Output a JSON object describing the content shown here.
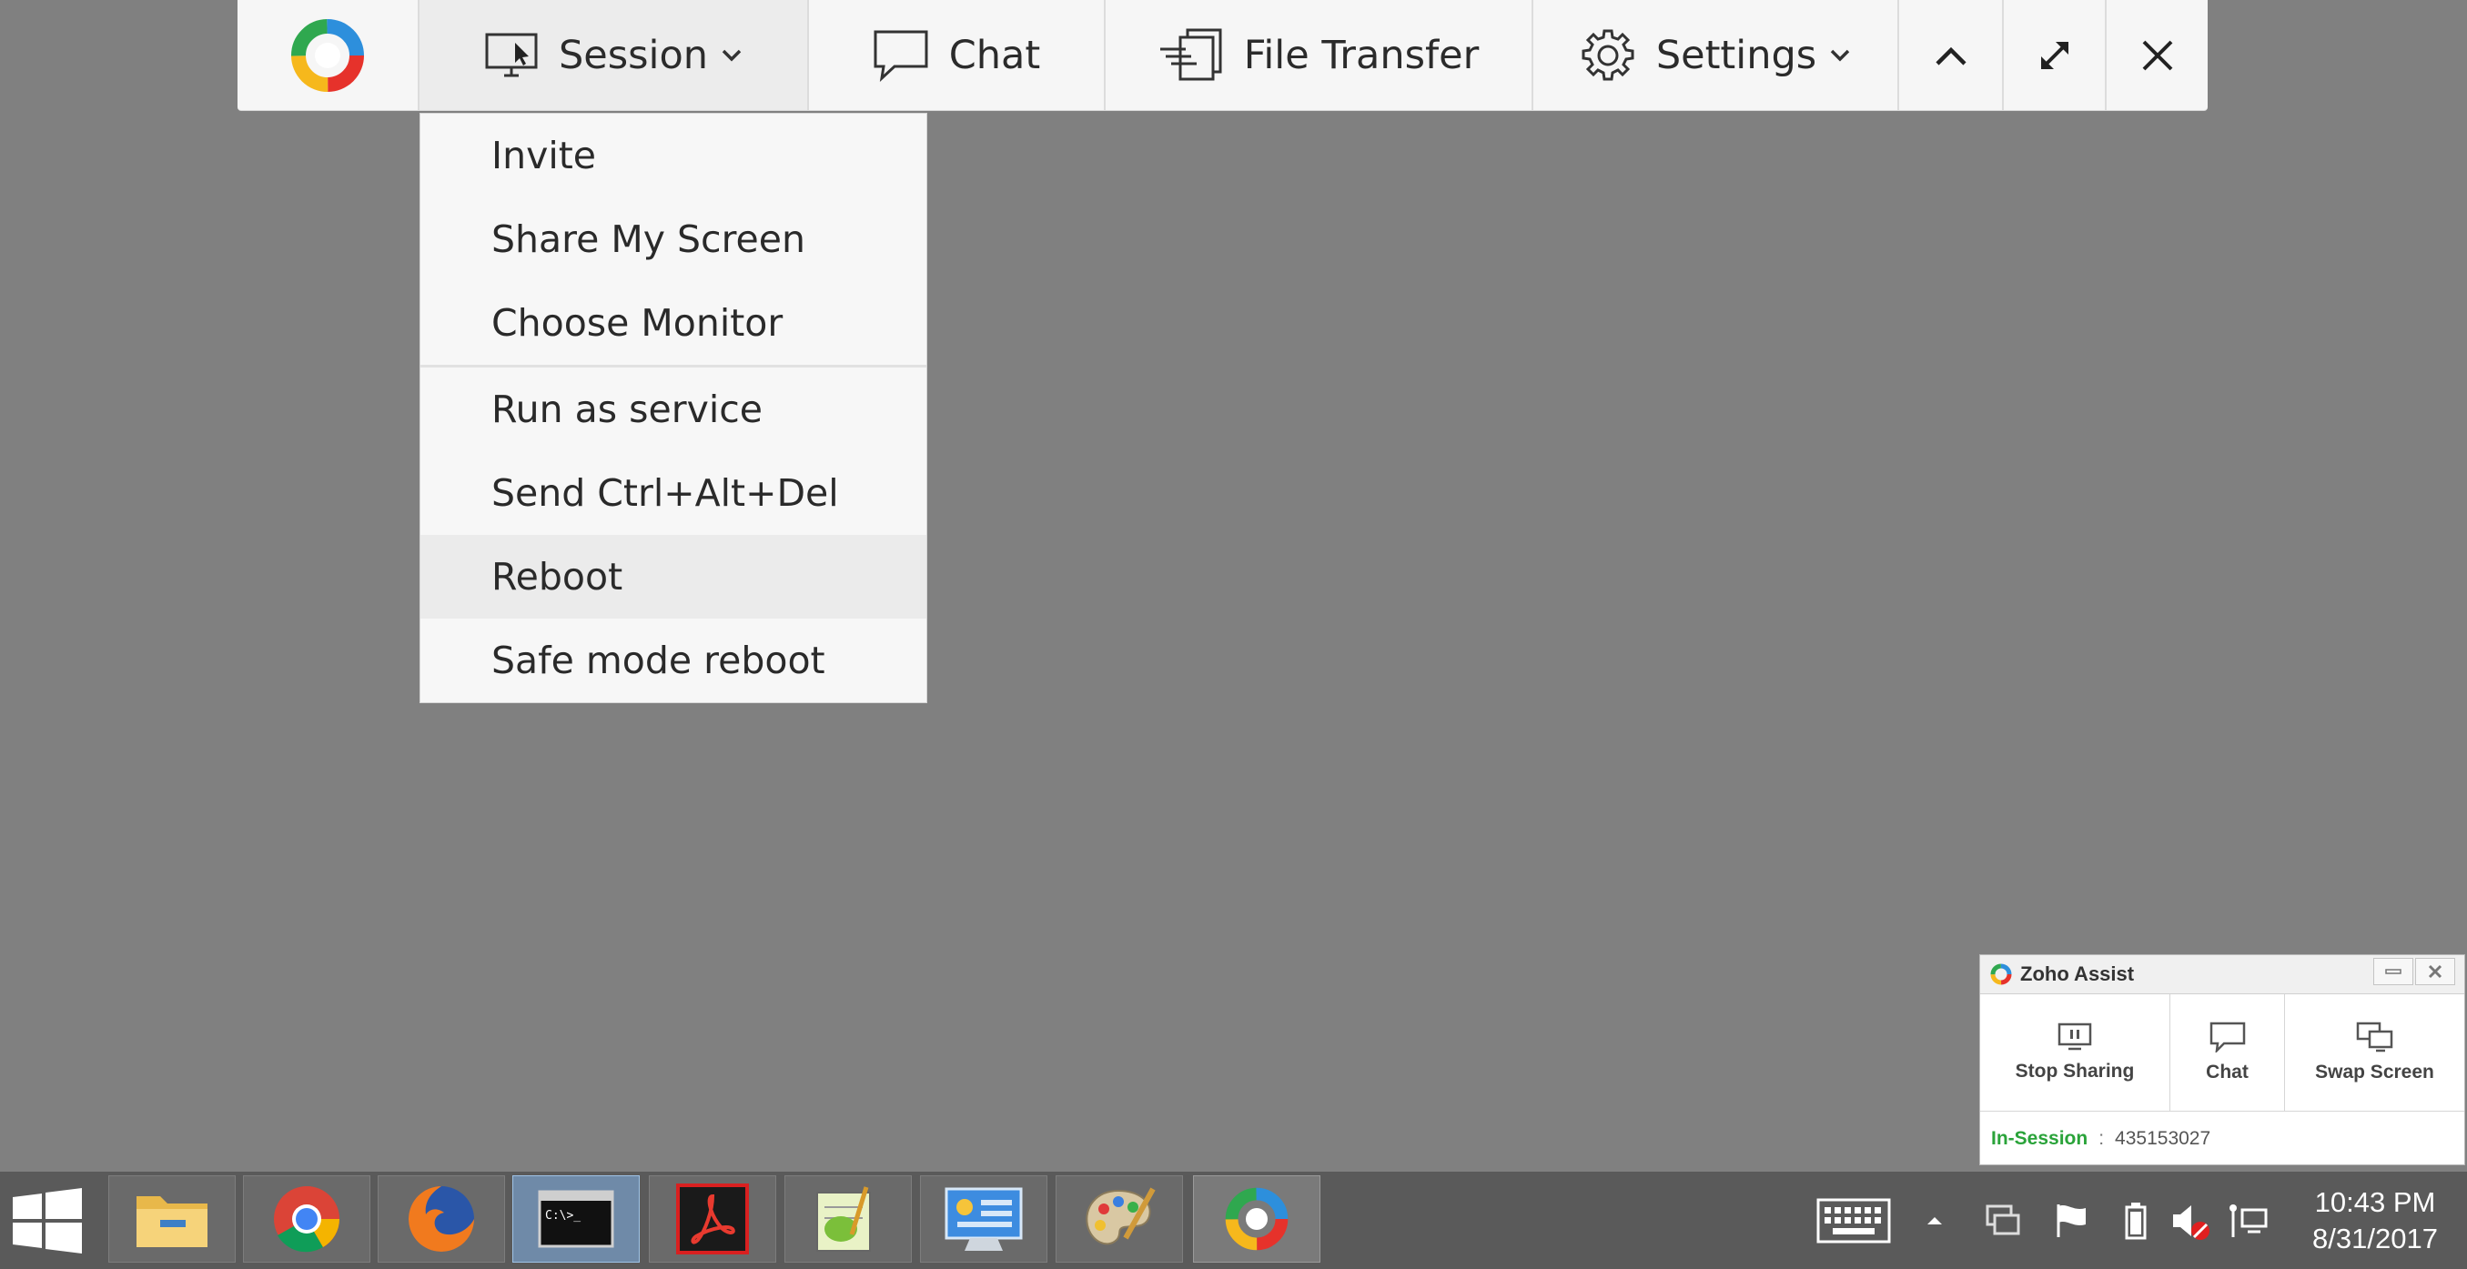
{
  "toolbar": {
    "session_label": "Session",
    "chat_label": "Chat",
    "file_transfer_label": "File Transfer",
    "settings_label": "Settings"
  },
  "session_menu": {
    "items": [
      "Invite",
      "Share My Screen",
      "Choose Monitor",
      "Run as service",
      "Send Ctrl+Alt+Del",
      "Reboot",
      "Safe mode reboot"
    ],
    "highlighted": "Reboot"
  },
  "zoho_panel": {
    "title": "Zoho Assist",
    "stop_sharing_label": "Stop Sharing",
    "chat_label": "Chat",
    "swap_screen_label": "Swap Screen",
    "status_label": "In-Session",
    "separator": ":",
    "session_id": "435153027"
  },
  "taskbar": {
    "apps": [
      "file-explorer",
      "chrome",
      "firefox",
      "command-prompt",
      "acrobat-reader",
      "notepad-plus-plus",
      "control-panel",
      "paint",
      "zoho-assist"
    ],
    "active_app": "command-prompt",
    "time": "10:43 PM",
    "date": "8/31/2017"
  },
  "colors": {
    "desktop_background": "#808080",
    "toolbar_background": "#f6f6f6",
    "in_session_green": "#2aa33a",
    "taskbar_background": "#5a5a5a"
  }
}
